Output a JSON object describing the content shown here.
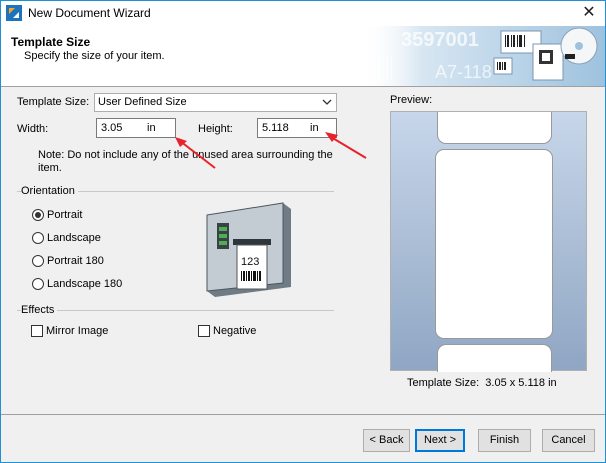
{
  "window": {
    "title": "New Document Wizard",
    "close": "✕"
  },
  "header": {
    "title": "Template Size",
    "subtitle": "Specify the size of your item.",
    "banner_text_1": "3597001",
    "banner_text_2": "A7-118"
  },
  "template_size": {
    "label": "Template Size:",
    "value": "User Defined Size"
  },
  "width": {
    "label": "Width:",
    "value": "3.05",
    "unit": "in"
  },
  "height": {
    "label": "Height:",
    "value": "5.118",
    "unit": "in"
  },
  "note": "Note: Do not include any of the unused area surrounding the item.",
  "orientation": {
    "label": "Orientation",
    "options": [
      "Portrait",
      "Landscape",
      "Portrait 180",
      "Landscape 180"
    ],
    "selected": "Portrait"
  },
  "printer_label_text": "123",
  "effects": {
    "label": "Effects",
    "mirror": {
      "label": "Mirror Image",
      "checked": false
    },
    "negative": {
      "label": "Negative",
      "checked": false
    }
  },
  "preview": {
    "label": "Preview:",
    "size_label": "Template Size:",
    "size_value": "3.05 x 5.118 in"
  },
  "buttons": {
    "back": "< Back",
    "next": "Next >",
    "finish": "Finish",
    "cancel": "Cancel"
  },
  "colors": {
    "accent": "#1e90d8",
    "annotation_arrow": "#e8212a",
    "preview_bg": "#a9bcd4"
  }
}
